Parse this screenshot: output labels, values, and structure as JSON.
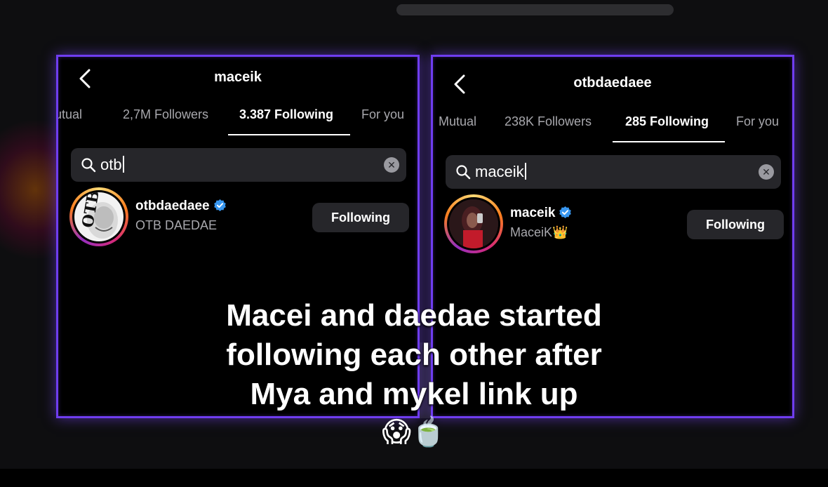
{
  "left_panel": {
    "title": "maceik",
    "tabs": [
      "Mutual",
      "2,7M Followers",
      "3.387 Following",
      "For you"
    ],
    "active_tab": "3.387 Following",
    "search_query": "otb",
    "result": {
      "username": "otbdaedaee",
      "full_name": "OTB DAEDAE",
      "verified": true,
      "button_label": "Following",
      "avatar_text": "OTB"
    }
  },
  "right_panel": {
    "title": "otbdaedaee",
    "tabs": [
      "Mutual",
      "238K Followers",
      "285 Following",
      "For you"
    ],
    "active_tab": "285 Following",
    "search_query": "maceik",
    "result": {
      "username": "maceik",
      "full_name": "MaceiK👑",
      "verified": true,
      "button_label": "Following"
    }
  },
  "caption": {
    "line1": "Macei and daedae started",
    "line2": "following each other after",
    "line3": "Mya and mykel link up",
    "emojis": "😱🍵"
  },
  "colors": {
    "panel_border": "#6f3df0",
    "verified_badge": "#3897f0",
    "button_bg": "#26262a",
    "muted_text": "#a8a8ad"
  },
  "icons": [
    "back-icon",
    "search-icon",
    "clear-icon",
    "verified-icon"
  ]
}
